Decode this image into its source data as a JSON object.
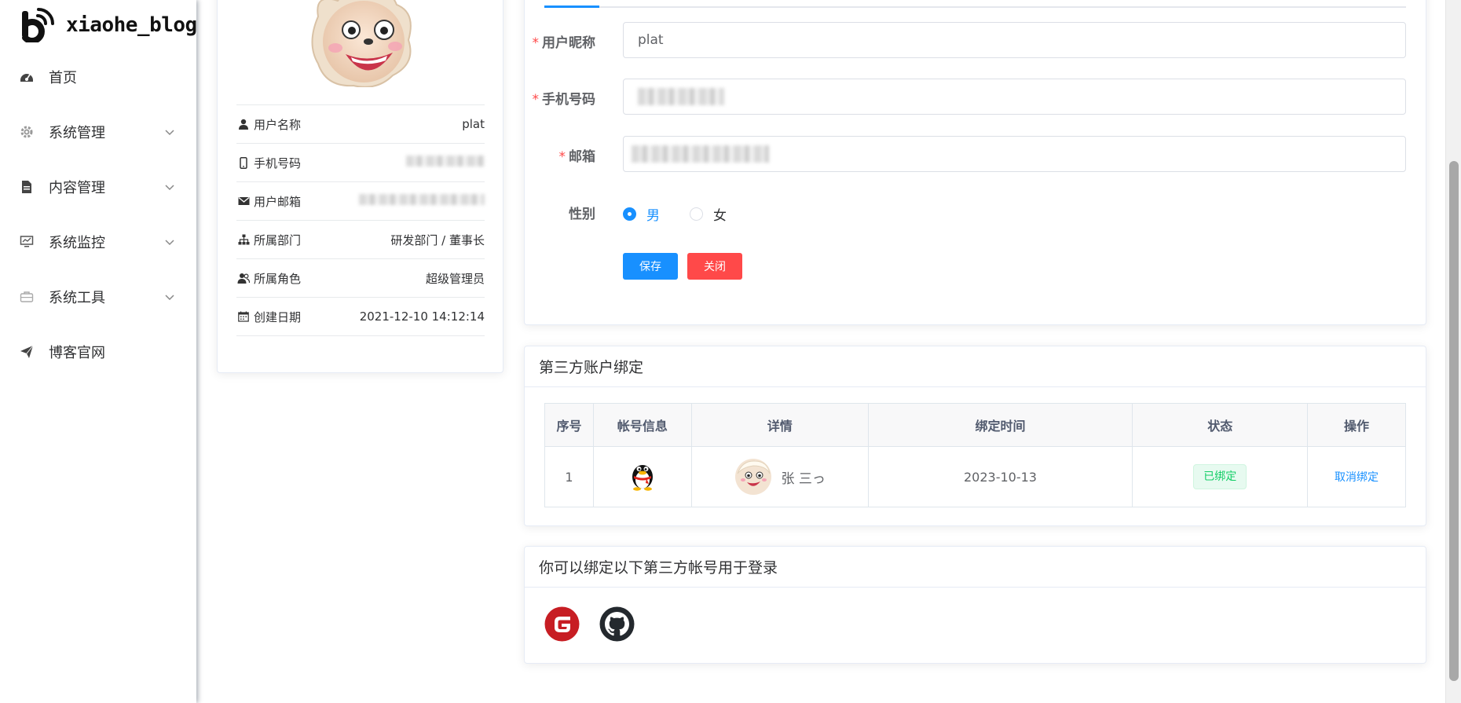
{
  "app": {
    "name": "xiaohe_blog"
  },
  "sidebar": {
    "items": [
      {
        "label": "首页",
        "icon": "dashboard-icon",
        "has_children": false
      },
      {
        "label": "系统管理",
        "icon": "gear-icon",
        "has_children": true
      },
      {
        "label": "内容管理",
        "icon": "document-icon",
        "has_children": true
      },
      {
        "label": "系统监控",
        "icon": "monitor-icon",
        "has_children": true
      },
      {
        "label": "系统工具",
        "icon": "toolbox-icon",
        "has_children": true
      },
      {
        "label": "博客官网",
        "icon": "paper-plane-icon",
        "has_children": false
      }
    ]
  },
  "profile": {
    "rows": [
      {
        "label": "用户名称",
        "value": "plat",
        "icon": "user-icon"
      },
      {
        "label": "手机号码",
        "value": "",
        "icon": "phone-icon",
        "redacted": true
      },
      {
        "label": "用户邮箱",
        "value": "",
        "icon": "mail-icon",
        "redacted": true
      },
      {
        "label": "所属部门",
        "value": "研发部门 / 董事长",
        "icon": "org-tree-icon"
      },
      {
        "label": "所属角色",
        "value": "超级管理员",
        "icon": "users-icon"
      },
      {
        "label": "创建日期",
        "value": "2021-12-10 14:12:14",
        "icon": "calendar-icon"
      }
    ]
  },
  "form": {
    "nickname_label": "用户昵称",
    "nickname_value": "plat",
    "phone_label": "手机号码",
    "email_label": "邮箱",
    "gender_label": "性别",
    "gender_male": "男",
    "gender_female": "女",
    "gender_selected": "男",
    "save_label": "保存",
    "close_label": "关闭",
    "required_mark": "*"
  },
  "bind": {
    "title": "第三方账户绑定",
    "headers": [
      "序号",
      "帐号信息",
      "详情",
      "绑定时间",
      "状态",
      "操作"
    ],
    "rows": [
      {
        "index": "1",
        "account_icon": "qq-penguin-icon",
        "name": "张 三っ",
        "time": "2023-10-13",
        "status": "已绑定",
        "action": "取消绑定"
      }
    ]
  },
  "login_options": {
    "title": "你可以绑定以下第三方帐号用于登录",
    "providers": [
      "gitee-icon",
      "github-icon"
    ]
  },
  "colors": {
    "primary": "#1890ff",
    "danger": "#ff4949",
    "success": "#13ce66"
  }
}
